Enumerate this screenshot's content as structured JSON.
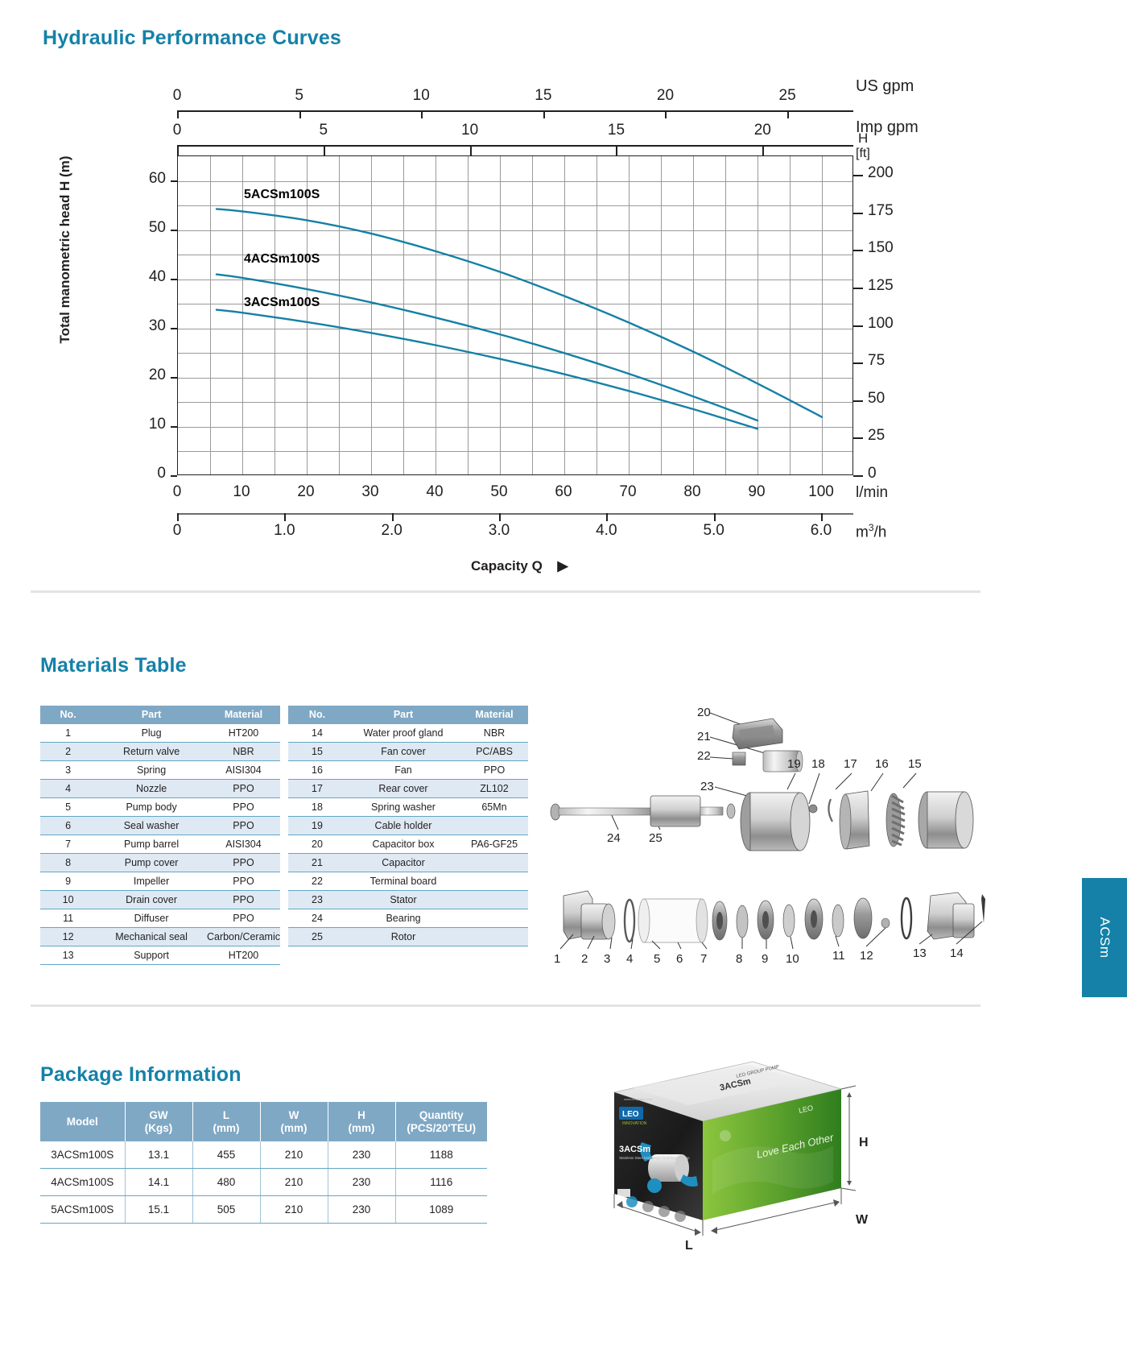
{
  "sections": {
    "hydraulic_title": "Hydraulic Performance Curves",
    "materials_title": "Materials Table",
    "package_title": "Package Information"
  },
  "side_tab": {
    "label": "ACSm"
  },
  "chart_data": {
    "type": "line",
    "title": "Hydraulic Performance Curves",
    "xlabel": "Capacity Q",
    "ylabel": "Total manometric head H (m)",
    "grid": true,
    "legend": "inline-labels",
    "axes": {
      "bottom_primary": {
        "unit": "l/min",
        "ticks": [
          0,
          10,
          20,
          30,
          40,
          50,
          60,
          70,
          80,
          90,
          100
        ],
        "range": [
          0,
          105
        ]
      },
      "bottom_secondary": {
        "unit": "m³/h",
        "ticks": [
          "0",
          "1.0",
          "2.0",
          "3.0",
          "4.0",
          "5.0",
          "6.0"
        ],
        "range": [
          0,
          6.3
        ]
      },
      "top_primary": {
        "unit": "US gpm",
        "ticks": [
          0,
          5,
          10,
          15,
          20,
          25
        ],
        "range": [
          0,
          27.7
        ]
      },
      "top_secondary": {
        "unit": "Imp gpm",
        "ticks": [
          0,
          5,
          10,
          15,
          20
        ],
        "range": [
          0,
          23.1
        ]
      },
      "left": {
        "unit": "m",
        "label": "Total manometric head H (m)",
        "ticks": [
          0,
          10,
          20,
          30,
          40,
          50,
          60
        ],
        "range": [
          0,
          65
        ]
      },
      "right": {
        "unit_line1": "H",
        "unit_line2": "[ft]",
        "ticks": [
          0,
          25,
          50,
          75,
          100,
          125,
          150,
          175,
          200
        ],
        "range": [
          0,
          213
        ]
      }
    },
    "series": [
      {
        "name": "5ACSm100S",
        "color": "#1580a5",
        "x": [
          6,
          10,
          20,
          30,
          40,
          50,
          60,
          70,
          80,
          90,
          100
        ],
        "y": [
          54.3,
          53.8,
          52.0,
          49.3,
          45.7,
          41.5,
          36.6,
          31.2,
          25.3,
          18.8,
          12.0
        ]
      },
      {
        "name": "4ACSm100S",
        "color": "#1580a5",
        "x": [
          6,
          10,
          20,
          30,
          40,
          50,
          60,
          70,
          80,
          90
        ],
        "y": [
          41.0,
          40.3,
          38.0,
          35.3,
          32.2,
          28.8,
          25.0,
          20.8,
          16.2,
          11.3
        ]
      },
      {
        "name": "3ACSm100S",
        "color": "#1580a5",
        "x": [
          6,
          10,
          20,
          30,
          40,
          50,
          60,
          70,
          80,
          90
        ],
        "y": [
          33.8,
          33.2,
          31.3,
          29.1,
          26.6,
          23.8,
          20.7,
          17.3,
          13.6,
          9.6
        ]
      }
    ]
  },
  "materials": {
    "headers": [
      "No.",
      "Part",
      "Material"
    ],
    "left_rows": [
      {
        "no": "1",
        "part": "Plug",
        "material": "HT200"
      },
      {
        "no": "2",
        "part": "Return valve",
        "material": "NBR"
      },
      {
        "no": "3",
        "part": "Spring",
        "material": "AISI304"
      },
      {
        "no": "4",
        "part": "Nozzle",
        "material": "PPO"
      },
      {
        "no": "5",
        "part": "Pump body",
        "material": "PPO"
      },
      {
        "no": "6",
        "part": "Seal washer",
        "material": "PPO"
      },
      {
        "no": "7",
        "part": "Pump barrel",
        "material": "AISI304"
      },
      {
        "no": "8",
        "part": "Pump cover",
        "material": "PPO"
      },
      {
        "no": "9",
        "part": "Impeller",
        "material": "PPO"
      },
      {
        "no": "10",
        "part": "Drain cover",
        "material": "PPO"
      },
      {
        "no": "11",
        "part": "Diffuser",
        "material": "PPO"
      },
      {
        "no": "12",
        "part": "Mechanical seal",
        "material": "Carbon/Ceramic"
      },
      {
        "no": "13",
        "part": "Support",
        "material": "HT200"
      }
    ],
    "right_rows": [
      {
        "no": "14",
        "part": "Water proof gland",
        "material": "NBR"
      },
      {
        "no": "15",
        "part": "Fan cover",
        "material": "PC/ABS"
      },
      {
        "no": "16",
        "part": "Fan",
        "material": "PPO"
      },
      {
        "no": "17",
        "part": "Rear cover",
        "material": "ZL102"
      },
      {
        "no": "18",
        "part": "Spring washer",
        "material": "65Mn"
      },
      {
        "no": "19",
        "part": "Cable holder",
        "material": ""
      },
      {
        "no": "20",
        "part": "Capacitor box",
        "material": "PA6-GF25"
      },
      {
        "no": "21",
        "part": "Capacitor",
        "material": ""
      },
      {
        "no": "22",
        "part": "Terminal board",
        "material": ""
      },
      {
        "no": "23",
        "part": "Stator",
        "material": ""
      },
      {
        "no": "24",
        "part": "Bearing",
        "material": ""
      },
      {
        "no": "25",
        "part": "Rotor",
        "material": ""
      }
    ]
  },
  "package": {
    "headers": [
      {
        "l1": "Model",
        "l2": ""
      },
      {
        "l1": "GW",
        "l2": "(Kgs)"
      },
      {
        "l1": "L",
        "l2": "(mm)"
      },
      {
        "l1": "W",
        "l2": "(mm)"
      },
      {
        "l1": "H",
        "l2": "(mm)"
      },
      {
        "l1": "Quantity",
        "l2": "(PCS/20'TEU)"
      }
    ],
    "rows": [
      {
        "model": "3ACSm100S",
        "gw": "13.1",
        "l": "455",
        "w": "210",
        "h": "230",
        "qty": "1188"
      },
      {
        "model": "4ACSm100S",
        "gw": "14.1",
        "l": "480",
        "w": "210",
        "h": "230",
        "qty": "1116"
      },
      {
        "model": "5ACSm100S",
        "gw": "15.1",
        "l": "505",
        "w": "210",
        "h": "230",
        "qty": "1089"
      }
    ]
  },
  "exploded_numbers": {
    "upper": [
      "20",
      "21",
      "22",
      "23",
      "19",
      "18",
      "17",
      "16",
      "15",
      "24",
      "25"
    ],
    "lower": [
      "1",
      "2",
      "3",
      "4",
      "5",
      "6",
      "7",
      "8",
      "9",
      "10",
      "11",
      "12",
      "13",
      "14"
    ]
  },
  "package_box_dims": {
    "h": "H",
    "w": "W",
    "l": "L"
  },
  "colors": {
    "brand": "#1581a8",
    "curve": "#1580a5",
    "table_header": "#7fa8c5",
    "table_stripe": "#dfe9f3"
  }
}
